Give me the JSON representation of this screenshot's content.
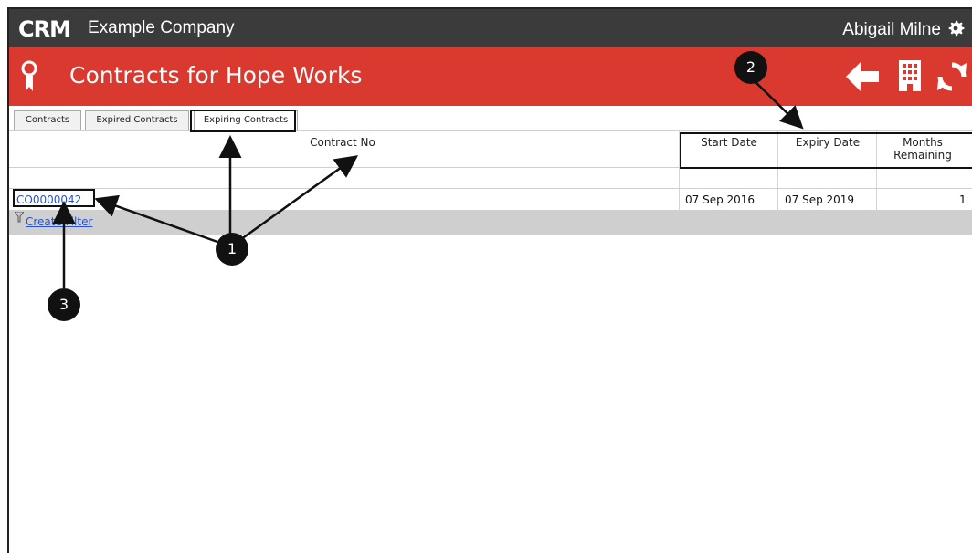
{
  "header": {
    "logo": "CRM",
    "company": "Example Company",
    "user": "Abigail Milne"
  },
  "page": {
    "title": "Contracts for Hope Works"
  },
  "tabs": [
    {
      "label": "Contracts"
    },
    {
      "label": "Expired Contracts"
    },
    {
      "label": "Expiring Contracts",
      "active": true
    }
  ],
  "table": {
    "columns": [
      "Contract No",
      "Start Date",
      "Expiry Date",
      "Months Remaining"
    ],
    "rows": [
      {
        "contract_no": "CO0000042",
        "start_date": "07 Sep 2016",
        "expiry_date": "07 Sep 2019",
        "months_remaining": "1"
      }
    ]
  },
  "footer": {
    "filter_label": "Create Filter"
  },
  "callouts": [
    "1",
    "2",
    "3"
  ],
  "colors": {
    "topbar": "#3b3b3b",
    "accent": "#d9392e",
    "link": "#2a52c9"
  }
}
